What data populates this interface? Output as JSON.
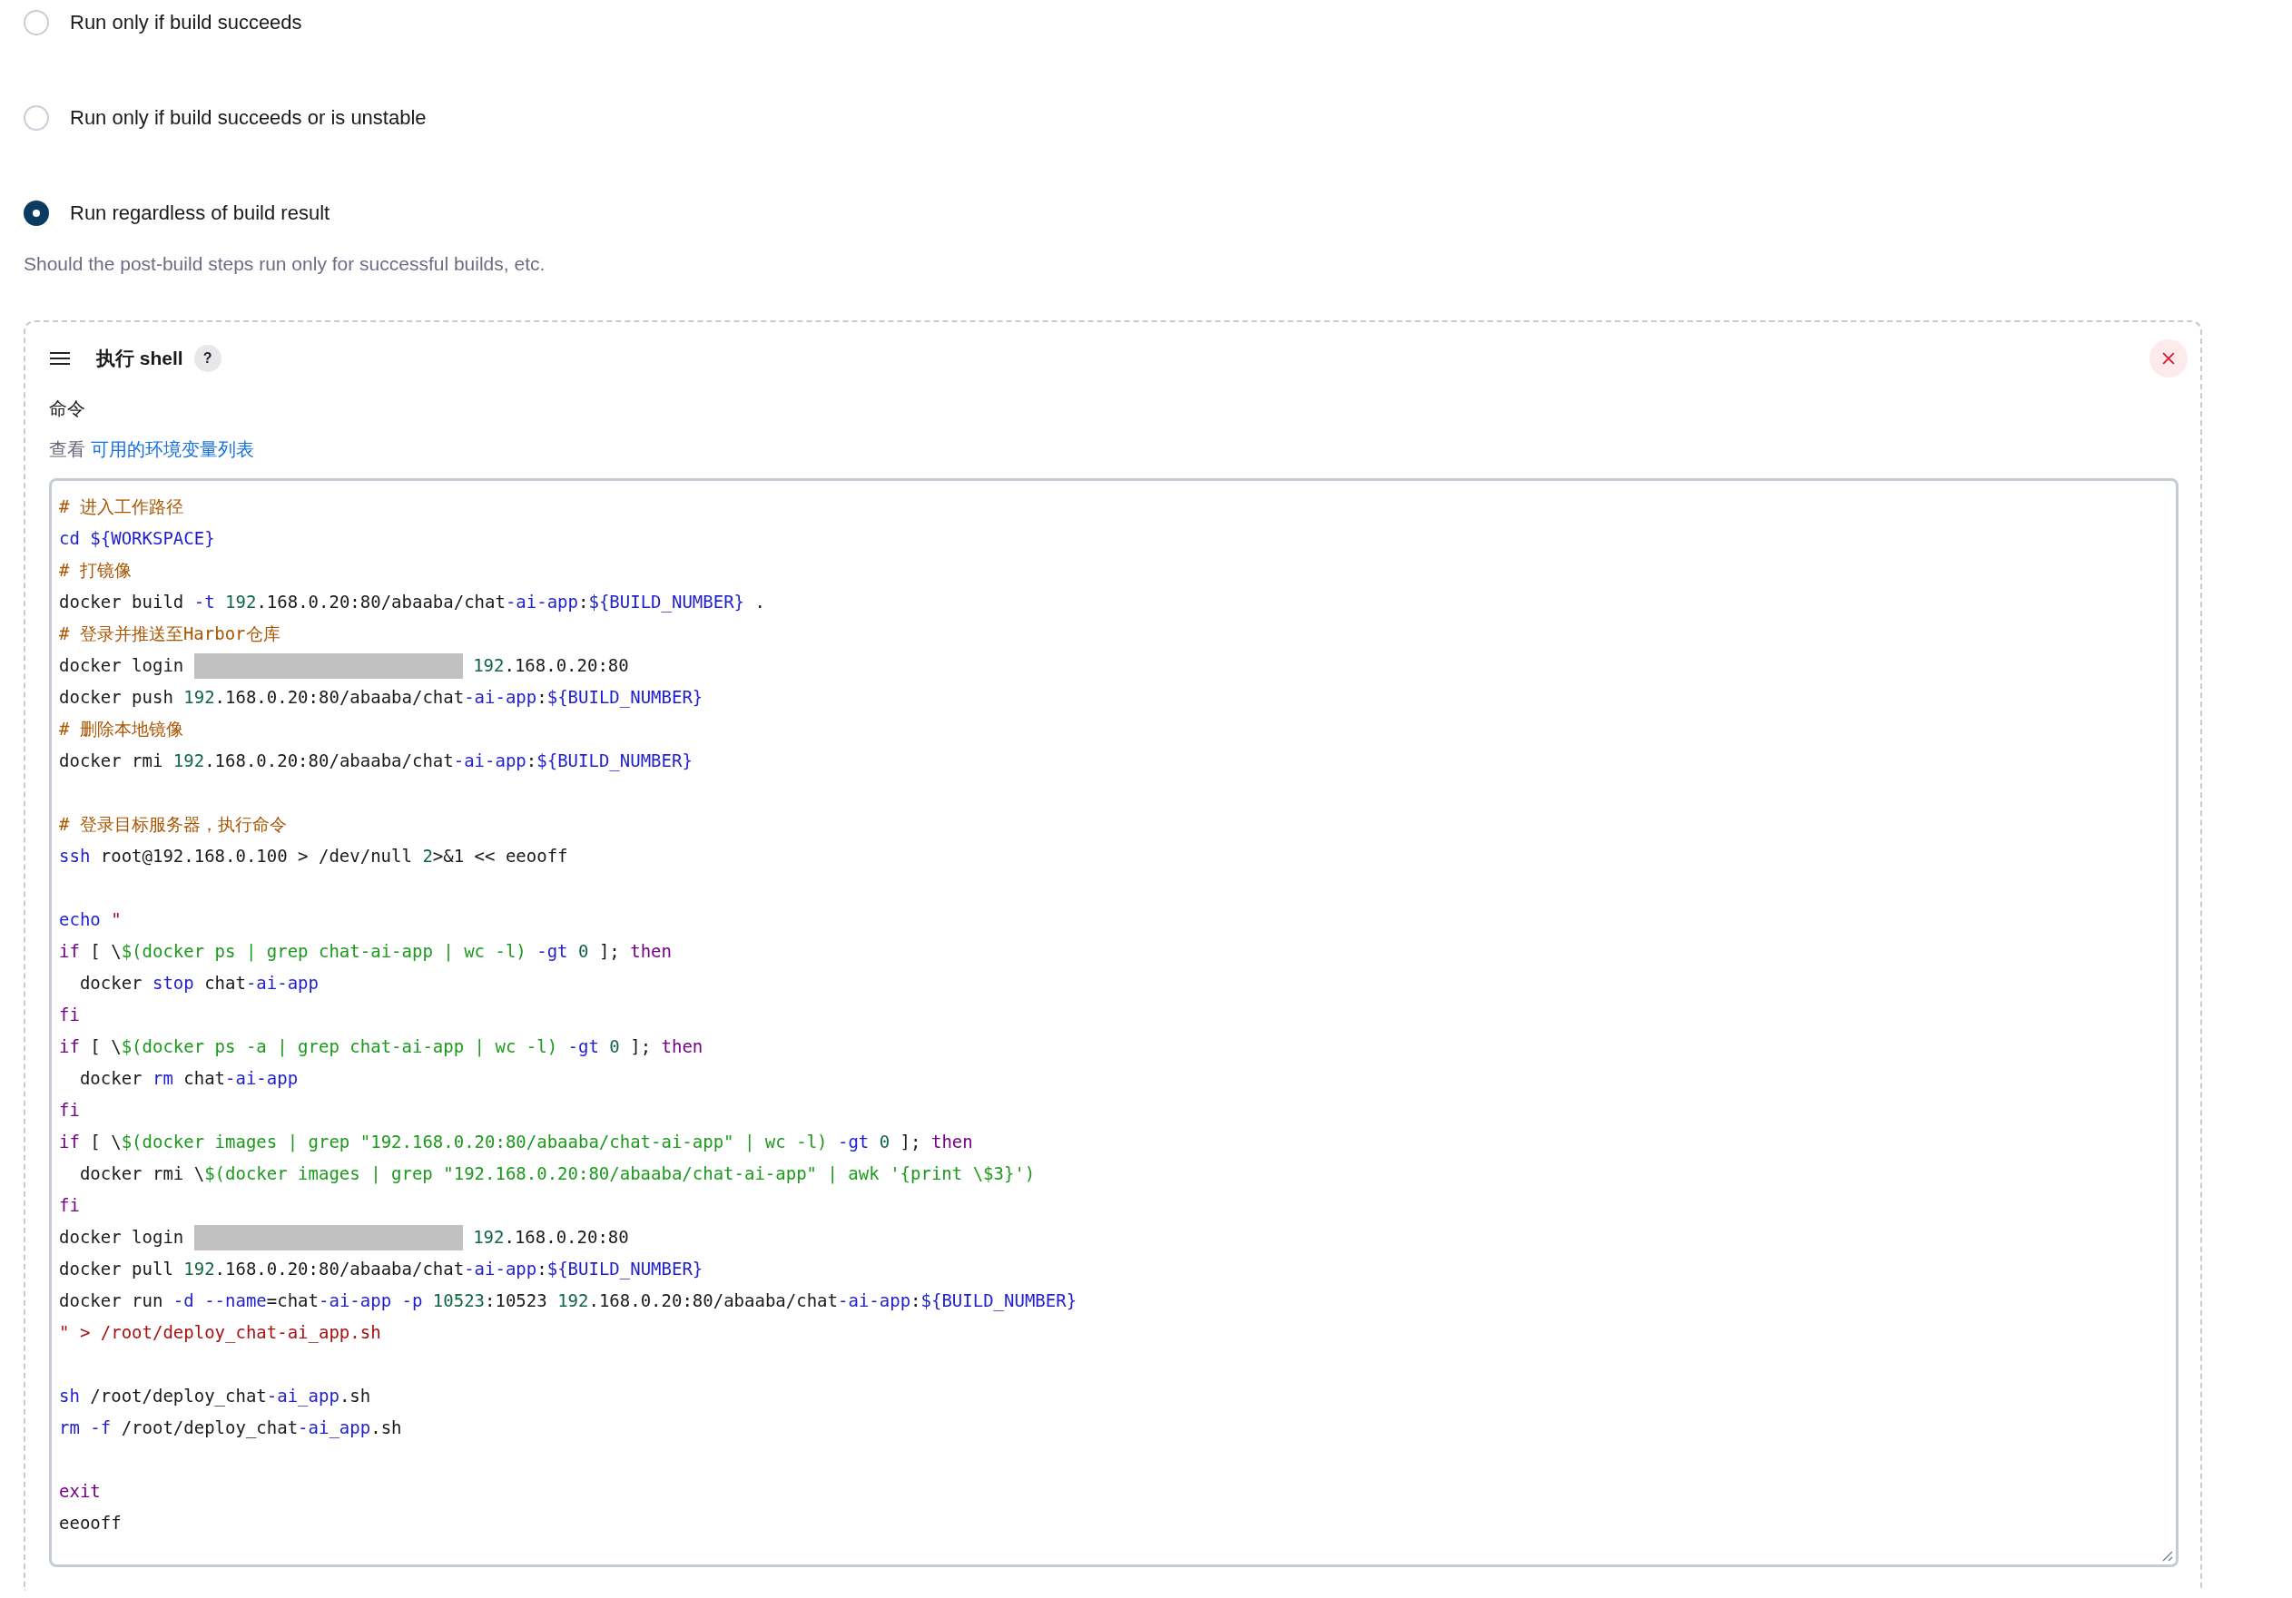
{
  "options": [
    {
      "label": "Run only if build succeeds",
      "selected": false
    },
    {
      "label": "Run only if build succeeds or is unstable",
      "selected": false
    },
    {
      "label": "Run regardless of build result",
      "selected": true
    }
  ],
  "options_help": "Should the post-build steps run only for successful builds, etc.",
  "step": {
    "title": "执行 shell",
    "help": "?",
    "field_label": "命令",
    "hint_prefix": "查看",
    "hint_link": "可用的环境变量列表",
    "lines": [
      {
        "kind": "code",
        "segments": [
          {
            "kind": "comment",
            "text": "# 进入工作路径"
          }
        ]
      },
      {
        "kind": "code",
        "segments": [
          {
            "kind": "builtin",
            "text": "cd ${WORKSPACE}"
          }
        ]
      },
      {
        "kind": "code",
        "segments": [
          {
            "kind": "comment",
            "text": "# 打镜像"
          }
        ]
      },
      {
        "kind": "code",
        "segments": [
          {
            "kind": "plain",
            "text": "docker build "
          },
          {
            "kind": "builtin",
            "text": "-t "
          },
          {
            "kind": "number",
            "text": "192"
          },
          {
            "kind": "plain",
            "text": ".168.0.20:80/abaaba/chat"
          },
          {
            "kind": "builtin",
            "text": "-ai-app"
          },
          {
            "kind": "plain",
            "text": ":"
          },
          {
            "kind": "builtin",
            "text": "${BUILD_NUMBER}"
          },
          {
            "kind": "plain",
            "text": " ."
          }
        ]
      },
      {
        "kind": "code",
        "segments": [
          {
            "kind": "comment",
            "text": "# 登录并推送至Harbor仓库"
          }
        ]
      },
      {
        "kind": "code",
        "segments": [
          {
            "kind": "plain",
            "text": "docker login "
          },
          {
            "kind": "redacted"
          },
          {
            "kind": "number",
            "text": " 192"
          },
          {
            "kind": "plain",
            "text": ".168.0.20:80"
          }
        ]
      },
      {
        "kind": "code",
        "segments": [
          {
            "kind": "plain",
            "text": "docker push "
          },
          {
            "kind": "number",
            "text": "192"
          },
          {
            "kind": "plain",
            "text": ".168.0.20:80/abaaba/chat"
          },
          {
            "kind": "builtin",
            "text": "-ai-app"
          },
          {
            "kind": "plain",
            "text": ":"
          },
          {
            "kind": "builtin",
            "text": "${BUILD_NUMBER}"
          }
        ]
      },
      {
        "kind": "code",
        "segments": [
          {
            "kind": "comment",
            "text": "# 删除本地镜像"
          }
        ]
      },
      {
        "kind": "code",
        "segments": [
          {
            "kind": "plain",
            "text": "docker rmi "
          },
          {
            "kind": "number",
            "text": "192"
          },
          {
            "kind": "plain",
            "text": ".168.0.20:80/abaaba/chat"
          },
          {
            "kind": "builtin",
            "text": "-ai-app"
          },
          {
            "kind": "plain",
            "text": ":"
          },
          {
            "kind": "builtin",
            "text": "${BUILD_NUMBER}"
          }
        ]
      },
      {
        "kind": "blank"
      },
      {
        "kind": "code",
        "segments": [
          {
            "kind": "comment",
            "text": "# 登录目标服务器，执行命令"
          }
        ]
      },
      {
        "kind": "code",
        "segments": [
          {
            "kind": "builtin",
            "text": "ssh"
          },
          {
            "kind": "plain",
            "text": " root@192.168.0.100 > /dev/null "
          },
          {
            "kind": "number",
            "text": "2"
          },
          {
            "kind": "plain",
            "text": ">&1 << eeooff"
          }
        ]
      },
      {
        "kind": "blank"
      },
      {
        "kind": "code",
        "segments": [
          {
            "kind": "builtin",
            "text": "echo "
          },
          {
            "kind": "string",
            "text": "\""
          }
        ]
      },
      {
        "kind": "code",
        "segments": [
          {
            "kind": "keyword",
            "text": "if"
          },
          {
            "kind": "plain",
            "text": " [ \\"
          },
          {
            "kind": "quote",
            "text": "$(docker ps | grep chat-ai-app | wc -l)"
          },
          {
            "kind": "builtin",
            "text": " -gt "
          },
          {
            "kind": "number",
            "text": "0"
          },
          {
            "kind": "plain",
            "text": " ]; "
          },
          {
            "kind": "keyword",
            "text": "then"
          }
        ]
      },
      {
        "kind": "code",
        "segments": [
          {
            "kind": "plain",
            "text": "  docker "
          },
          {
            "kind": "builtin",
            "text": "stop"
          },
          {
            "kind": "plain",
            "text": " chat"
          },
          {
            "kind": "builtin",
            "text": "-ai-app"
          }
        ]
      },
      {
        "kind": "code",
        "segments": [
          {
            "kind": "keyword",
            "text": "fi"
          }
        ]
      },
      {
        "kind": "code",
        "segments": [
          {
            "kind": "keyword",
            "text": "if"
          },
          {
            "kind": "plain",
            "text": " [ \\"
          },
          {
            "kind": "quote",
            "text": "$(docker ps -a | grep chat-ai-app | wc -l)"
          },
          {
            "kind": "builtin",
            "text": " -gt "
          },
          {
            "kind": "number",
            "text": "0"
          },
          {
            "kind": "plain",
            "text": " ]; "
          },
          {
            "kind": "keyword",
            "text": "then"
          }
        ]
      },
      {
        "kind": "code",
        "segments": [
          {
            "kind": "plain",
            "text": "  docker "
          },
          {
            "kind": "builtin",
            "text": "rm"
          },
          {
            "kind": "plain",
            "text": " chat"
          },
          {
            "kind": "builtin",
            "text": "-ai-app"
          }
        ]
      },
      {
        "kind": "code",
        "segments": [
          {
            "kind": "keyword",
            "text": "fi"
          }
        ]
      },
      {
        "kind": "code",
        "segments": [
          {
            "kind": "keyword",
            "text": "if"
          },
          {
            "kind": "plain",
            "text": " [ \\"
          },
          {
            "kind": "quote",
            "text": "$(docker images | grep \"192.168.0.20:80/abaaba/chat-ai-app\" | wc -l)"
          },
          {
            "kind": "builtin",
            "text": " -gt "
          },
          {
            "kind": "number",
            "text": "0"
          },
          {
            "kind": "plain",
            "text": " ]; "
          },
          {
            "kind": "keyword",
            "text": "then"
          }
        ]
      },
      {
        "kind": "code",
        "segments": [
          {
            "kind": "plain",
            "text": "  docker rmi \\"
          },
          {
            "kind": "quote",
            "text": "$(docker images | grep \"192.168.0.20:80/abaaba/chat-ai-app\" | awk '{print \\$3}')"
          }
        ]
      },
      {
        "kind": "code",
        "segments": [
          {
            "kind": "keyword",
            "text": "fi"
          }
        ]
      },
      {
        "kind": "code",
        "segments": [
          {
            "kind": "plain",
            "text": "docker login "
          },
          {
            "kind": "redacted"
          },
          {
            "kind": "number",
            "text": " 192"
          },
          {
            "kind": "plain",
            "text": ".168.0.20:80"
          }
        ]
      },
      {
        "kind": "code",
        "segments": [
          {
            "kind": "plain",
            "text": "docker pull "
          },
          {
            "kind": "number",
            "text": "192"
          },
          {
            "kind": "plain",
            "text": ".168.0.20:80/abaaba/chat"
          },
          {
            "kind": "builtin",
            "text": "-ai-app"
          },
          {
            "kind": "plain",
            "text": ":"
          },
          {
            "kind": "builtin",
            "text": "${BUILD_NUMBER}"
          }
        ]
      },
      {
        "kind": "code",
        "segments": [
          {
            "kind": "plain",
            "text": "docker run "
          },
          {
            "kind": "builtin",
            "text": "-d --name"
          },
          {
            "kind": "plain",
            "text": "=chat"
          },
          {
            "kind": "builtin",
            "text": "-ai-app -p "
          },
          {
            "kind": "number",
            "text": "10523"
          },
          {
            "kind": "plain",
            "text": ":10523 "
          },
          {
            "kind": "number",
            "text": "192"
          },
          {
            "kind": "plain",
            "text": ".168.0.20:80/abaaba/chat"
          },
          {
            "kind": "builtin",
            "text": "-ai-app"
          },
          {
            "kind": "plain",
            "text": ":"
          },
          {
            "kind": "builtin",
            "text": "${BUILD_NUMBER}"
          }
        ]
      },
      {
        "kind": "code",
        "segments": [
          {
            "kind": "string",
            "text": "\" > /root/deploy_chat-ai_app.sh"
          }
        ]
      },
      {
        "kind": "blank"
      },
      {
        "kind": "code",
        "segments": [
          {
            "kind": "builtin",
            "text": "sh"
          },
          {
            "kind": "plain",
            "text": " /root/deploy_chat"
          },
          {
            "kind": "builtin",
            "text": "-ai_app"
          },
          {
            "kind": "plain",
            "text": ".sh"
          }
        ]
      },
      {
        "kind": "code",
        "segments": [
          {
            "kind": "builtin",
            "text": "rm -f"
          },
          {
            "kind": "plain",
            "text": " /root/deploy_chat"
          },
          {
            "kind": "builtin",
            "text": "-ai_app"
          },
          {
            "kind": "plain",
            "text": ".sh"
          }
        ]
      },
      {
        "kind": "blank"
      },
      {
        "kind": "code",
        "segments": [
          {
            "kind": "keyword",
            "text": "exit"
          }
        ]
      },
      {
        "kind": "code",
        "segments": [
          {
            "kind": "plain",
            "text": "eeooff"
          }
        ]
      }
    ]
  }
}
